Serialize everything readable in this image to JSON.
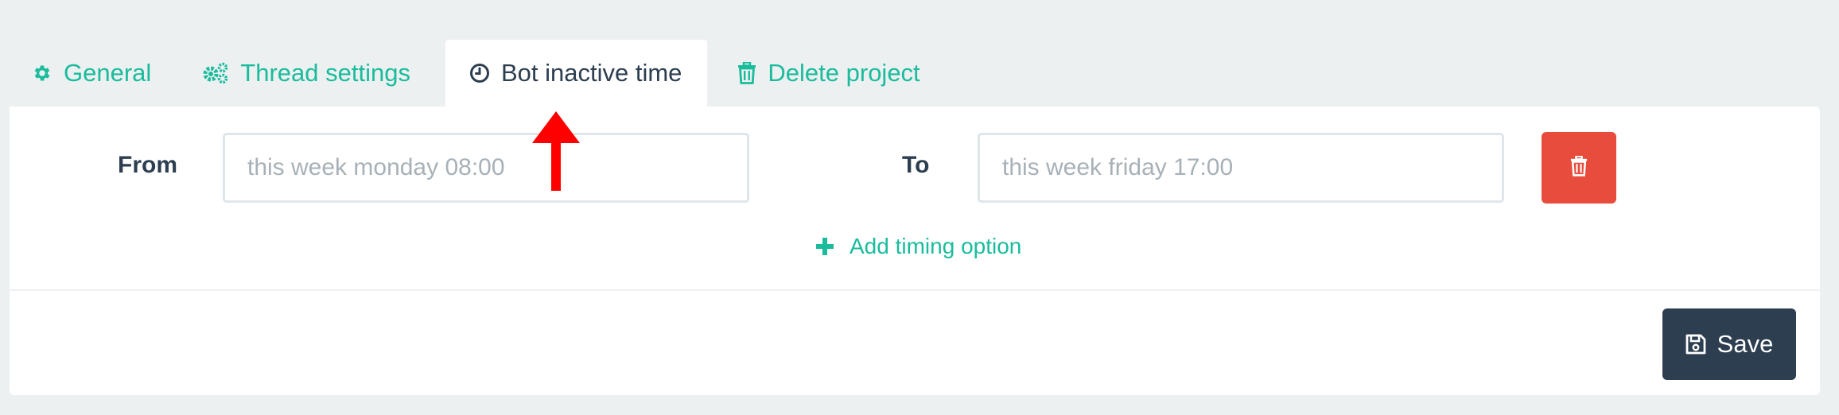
{
  "tabs": [
    {
      "label": "General",
      "icon": "gear-icon"
    },
    {
      "label": "Thread settings",
      "icon": "gears-icon"
    },
    {
      "label": "Bot inactive time",
      "icon": "clock-icon",
      "active": true
    },
    {
      "label": "Delete project",
      "icon": "trash-icon"
    }
  ],
  "form": {
    "from_label": "From",
    "from_placeholder": "this week monday 08:00",
    "to_label": "To",
    "to_placeholder": "this week friday 17:00",
    "add_option_label": "Add timing option",
    "save_label": "Save"
  },
  "colors": {
    "accent": "#1abc9c",
    "danger": "#e74c3c",
    "primary_dark": "#2c3e50",
    "annotation": "#ff0000",
    "background": "#ecf0f1"
  }
}
